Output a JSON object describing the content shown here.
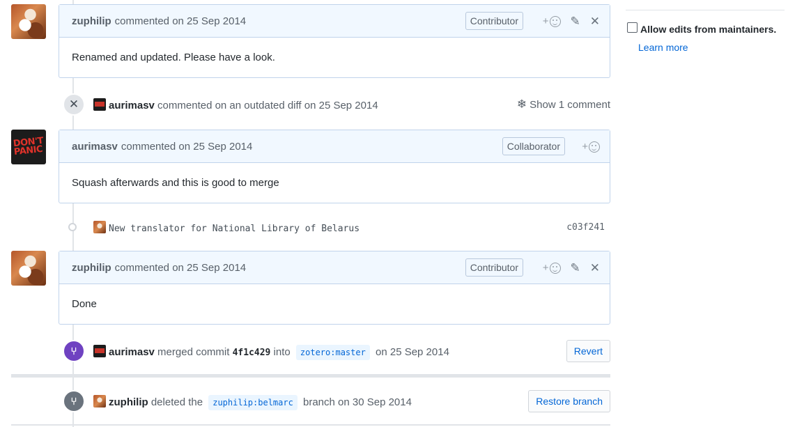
{
  "comments": [
    {
      "author": "zuphilip",
      "meta": "commented on 25 Sep 2014",
      "role": "Contributor",
      "body": "Renamed and updated. Please have a look."
    },
    {
      "author": "aurimasv",
      "meta": "commented on 25 Sep 2014",
      "role": "Collaborator",
      "body": "Squash afterwards and this is good to merge"
    },
    {
      "author": "zuphilip",
      "meta": "commented on 25 Sep 2014",
      "role": "Contributor",
      "body": "Done"
    }
  ],
  "avatar_text": {
    "panic_line1": "DON'T",
    "panic_line2": "PANIC"
  },
  "reaction": {
    "plus": "+"
  },
  "outdated": {
    "author": "aurimasv",
    "text": "commented on an outdated diff on 25 Sep 2014",
    "show_label": "Show 1 comment"
  },
  "commit": {
    "message": "New translator for National Library of Belarus",
    "sha": "c03f241"
  },
  "merge": {
    "author": "aurimasv",
    "text1": "merged commit",
    "sha": "4f1c429",
    "text2": "into",
    "branch": "zotero:master",
    "text3": "on 25 Sep 2014",
    "button": "Revert"
  },
  "delete": {
    "author": "zuphilip",
    "text1": "deleted the",
    "branch": "zuphilip:belmarc",
    "text2": "branch on 30 Sep 2014",
    "button": "Restore branch"
  },
  "sidebar": {
    "allow_edits_label": "Allow edits from maintainers.",
    "learn_more": "Learn more"
  },
  "colors": {
    "merged_purple": "#6f42c1",
    "deleted_gray": "#6a737d",
    "link_blue": "#0366d6",
    "header_bg": "#f1f8ff"
  }
}
